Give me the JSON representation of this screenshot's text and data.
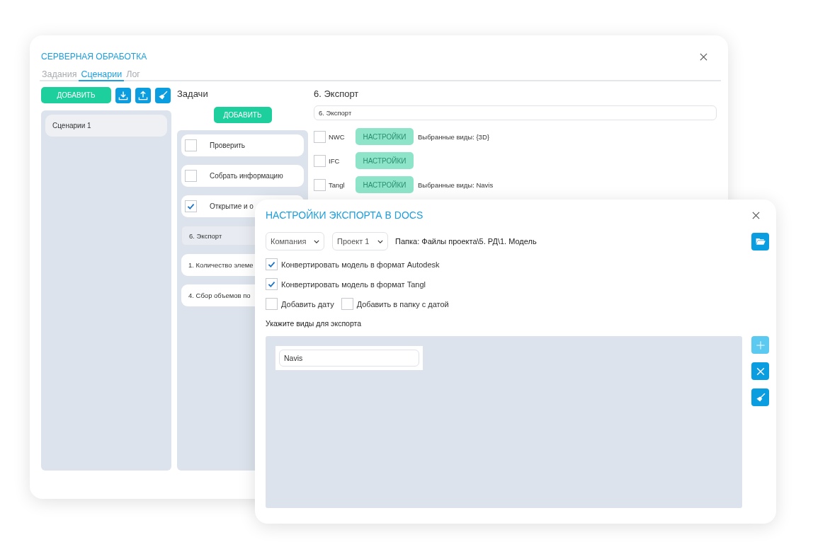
{
  "main_window": {
    "title": "СЕРВЕРНАЯ ОБРАБОТКА",
    "tabs": [
      {
        "label": "Задания",
        "selected": false
      },
      {
        "label": "Сценарии",
        "selected": true
      },
      {
        "label": "Лог",
        "selected": false
      }
    ],
    "scenarios": {
      "add_button": "ДОБАВИТЬ",
      "items": [
        "Сценарии 1"
      ]
    },
    "tasks": {
      "heading": "Задачи",
      "add_button": "ДОБАВИТЬ",
      "items": [
        {
          "kind": "checkbox",
          "label": "Проверить",
          "checked": false
        },
        {
          "kind": "checkbox",
          "label": "Собрать информацию",
          "checked": false
        },
        {
          "kind": "checkbox",
          "label": "Открытие и о",
          "checked": true
        },
        {
          "kind": "step",
          "label": "6. Экспорт",
          "selected": true
        },
        {
          "kind": "step",
          "label": "1. Количество элеме",
          "selected": false
        },
        {
          "kind": "step",
          "label": "4. Сбор объемов по",
          "selected": false
        }
      ]
    },
    "details": {
      "heading": "6. Экспорт",
      "name_value": "6. Экспорт",
      "formats": [
        {
          "label": "NWC",
          "checked": false,
          "button": "НАСТРОЙКИ",
          "disabled": true,
          "views": "Выбранные виды: {3D}"
        },
        {
          "label": "IFC",
          "checked": false,
          "button": "НАСТРОЙКИ",
          "disabled": true
        },
        {
          "label": "Tangl",
          "checked": false,
          "button": "НАСТРОЙКИ",
          "disabled": true,
          "views": "Выбранные виды: Navis"
        }
      ]
    }
  },
  "export_dialog": {
    "title": "НАСТРОЙКИ ЭКСПОРТА В DOCS",
    "company": "Компания",
    "project": "Проект 1",
    "folder": "Папка: Файлы проекта\\5. РД\\1. Модель",
    "option_rows": [
      [
        {
          "label": "Конвертировать модель в формат Autodesk",
          "checked": true
        }
      ],
      [
        {
          "label": "Конвертировать модель в формат Tangl",
          "checked": true
        }
      ],
      [
        {
          "label": "Добавить дату",
          "checked": false
        },
        {
          "label": "Добавить в папку с датой",
          "checked": false
        }
      ]
    ],
    "views_label": "Укажите виды для экспорта",
    "views": [
      "Navis"
    ],
    "side_buttons": [
      {
        "kind": "add",
        "disabled": true
      },
      {
        "kind": "remove",
        "disabled": false
      },
      {
        "kind": "clear",
        "disabled": false
      }
    ]
  }
}
